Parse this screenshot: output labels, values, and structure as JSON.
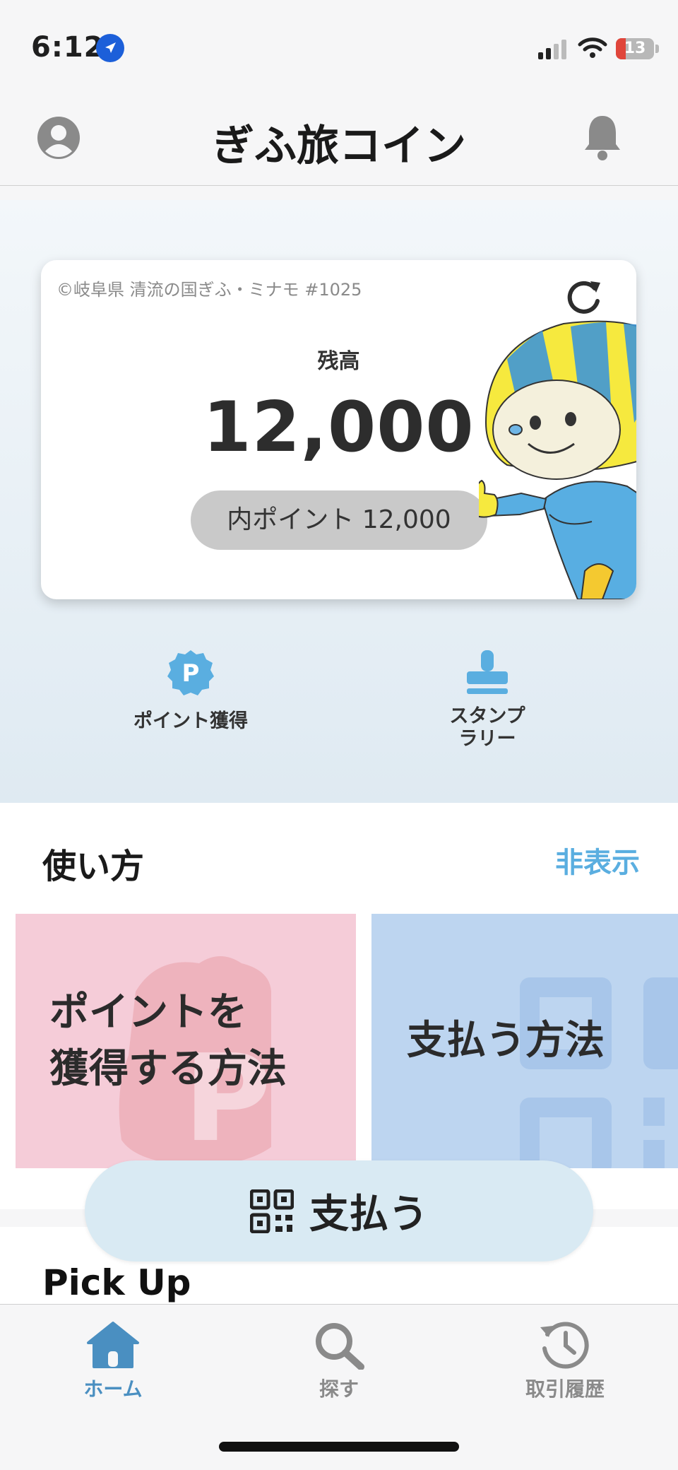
{
  "status_bar": {
    "time": "6:12",
    "battery": "13"
  },
  "header": {
    "title": "ぎふ旅コイン"
  },
  "balance_card": {
    "credit": "©岐阜県 清流の国ぎふ・ミナモ #1025",
    "label": "残高",
    "value": "12,000",
    "points_label": "内ポイント 12,000"
  },
  "actions": {
    "points": "ポイント獲得",
    "stamp_line1": "スタンプ",
    "stamp_line2": "ラリー"
  },
  "howto": {
    "title": "使い方",
    "hide": "非表示",
    "earn_line1": "ポイントを",
    "earn_line2": "獲得する方法",
    "pay": "支払う方法"
  },
  "pickup": {
    "title": "Pick Up"
  },
  "pay_button": {
    "label": "支払う"
  },
  "tabs": {
    "home": "ホーム",
    "search": "探す",
    "history": "取引履歴"
  },
  "colors": {
    "accent": "#4a8fc1",
    "link": "#5aaee0",
    "pay_button_bg": "#d9eaf3"
  }
}
